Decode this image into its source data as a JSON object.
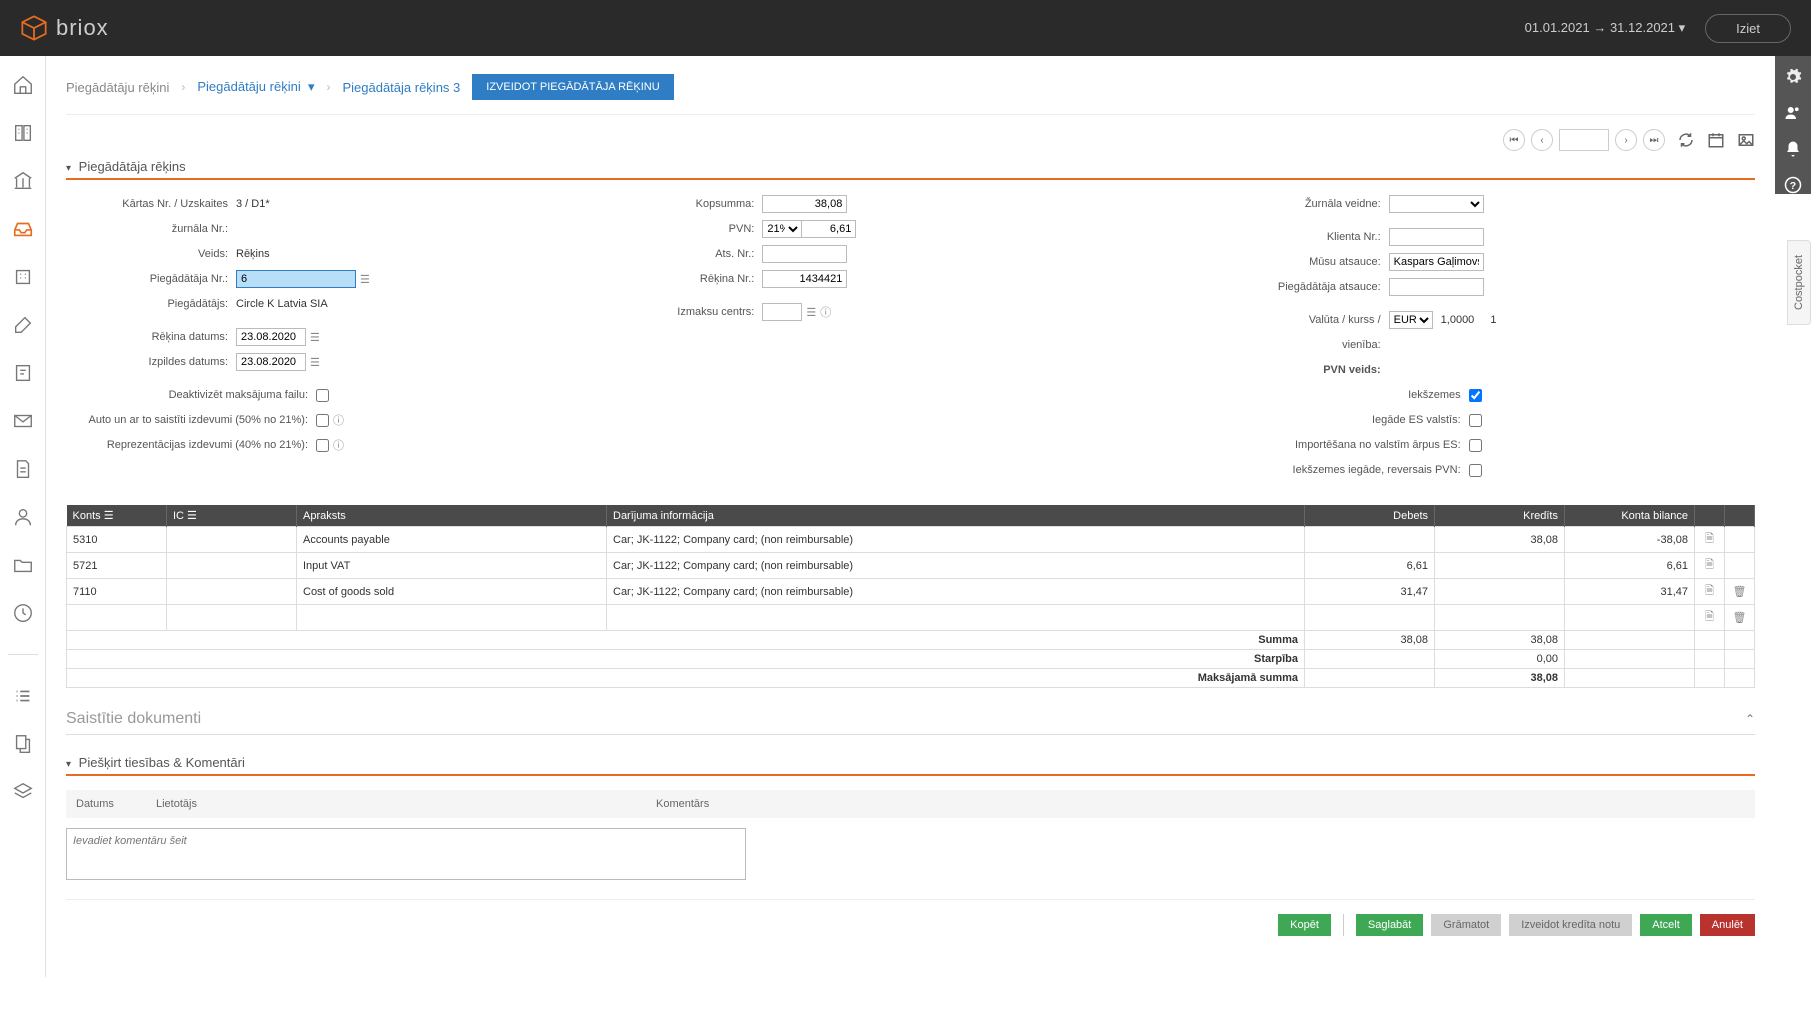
{
  "header": {
    "brand": "briox",
    "date_range": "01.01.2021 → 31.12.2021",
    "logout": "Iziet"
  },
  "breadcrumb": {
    "root": "Piegādātāju rēķini",
    "level1": "Piegādātāju rēķini",
    "level2": "Piegādātāja rēķins 3",
    "create_btn": "IZVEIDOT PIEGĀDĀTĀJA RĒĶINU"
  },
  "section": {
    "title": "Piegādātāja rēķins"
  },
  "form_left": {
    "serial_label": "Kārtas Nr. / Uzskaites",
    "serial_value": "3 / D1*",
    "journal_label": "žurnāla Nr.:",
    "journal_value": "",
    "type_label": "Veids:",
    "type_value": "Rēķins",
    "supplier_no_label": "Piegādātāja Nr.:",
    "supplier_no_value": "6",
    "supplier_label": "Piegādātājs:",
    "supplier_value": "Circle K Latvia SIA",
    "inv_date_label": "Rēķina datums:",
    "inv_date_value": "23.08.2020",
    "exec_date_label": "Izpildes datums:",
    "exec_date_value": "23.08.2020",
    "deactivate_label": "Deaktivizēt maksājuma failu:",
    "auto_label": "Auto un ar to saistīti izdevumi (50% no 21%):",
    "repr_label": "Reprezentācijas izdevumi (40% no 21%):"
  },
  "form_mid": {
    "total_label": "Kopsumma:",
    "total_value": "38,08",
    "vat_label": "PVN:",
    "vat_rate": "21%",
    "vat_value": "6,61",
    "ref_label": "Ats. Nr.:",
    "ref_value": "",
    "invno_label": "Rēķina Nr.:",
    "invno_value": "1434421",
    "cost_center_label": "Izmaksu centrs:",
    "cost_center_value": ""
  },
  "form_right": {
    "template_label": "Žurnāla veidne:",
    "client_label": "Klienta Nr.:",
    "client_value": "",
    "our_ref_label": "Mūsu atsauce:",
    "our_ref_value": "Kaspars Gaļimovs,ka:",
    "supp_ref_label": "Piegādātāja atsauce:",
    "supp_ref_value": "",
    "currency_label": "Valūta / kurss /",
    "currency_sel": "EUR",
    "currency_rate": "1,0000",
    "currency_one": "1",
    "unit_label": "vienība:",
    "vat_type_label": "PVN veids:",
    "domestic_label": "Iekšzemes",
    "eu_label": "Iegāde ES valstīs:",
    "import_label": "Importēšana no valstīm ārpus ES:",
    "reverse_label": "Iekšzemes iegāde, reversais PVN:"
  },
  "table": {
    "headers": {
      "account": "Konts",
      "ic": "IC",
      "desc": "Apraksts",
      "trans": "Darījuma informācija",
      "debit": "Debets",
      "credit": "Kredīts",
      "balance": "Konta bilance"
    },
    "rows": [
      {
        "account": "5310",
        "ic": "",
        "desc": "Accounts payable",
        "trans": "Car; JK-1122; Company card; (non reimbursable)",
        "debit": "",
        "credit": "38,08",
        "balance": "-38,08"
      },
      {
        "account": "5721",
        "ic": "",
        "desc": "Input VAT",
        "trans": "Car; JK-1122; Company card; (non reimbursable)",
        "debit": "6,61",
        "credit": "",
        "balance": "6,61"
      },
      {
        "account": "7110",
        "ic": "",
        "desc": "Cost of goods sold",
        "trans": "Car; JK-1122; Company card; (non reimbursable)",
        "debit": "31,47",
        "credit": "",
        "balance": "31,47"
      }
    ],
    "summary": {
      "sum_label": "Summa",
      "sum_debit": "38,08",
      "sum_credit": "38,08",
      "diff_label": "Starpība",
      "diff_val": "0,00",
      "pay_label": "Maksājamā summa",
      "pay_val": "38,08"
    }
  },
  "related": {
    "title": "Saistītie dokumenti"
  },
  "rights": {
    "title": "Piešķirt tiesības & Komentāri",
    "col_date": "Datums",
    "col_user": "Lietotājs",
    "col_comment": "Komentārs",
    "placeholder": "Ievadiet komentāru šeit"
  },
  "footer": {
    "copy": "Kopēt",
    "save": "Saglabāt",
    "book": "Grāmatot",
    "credit": "Izveidot kredīta notu",
    "cancel": "Atcelt",
    "void": "Anulēt"
  },
  "costpocket": "Costpocket"
}
